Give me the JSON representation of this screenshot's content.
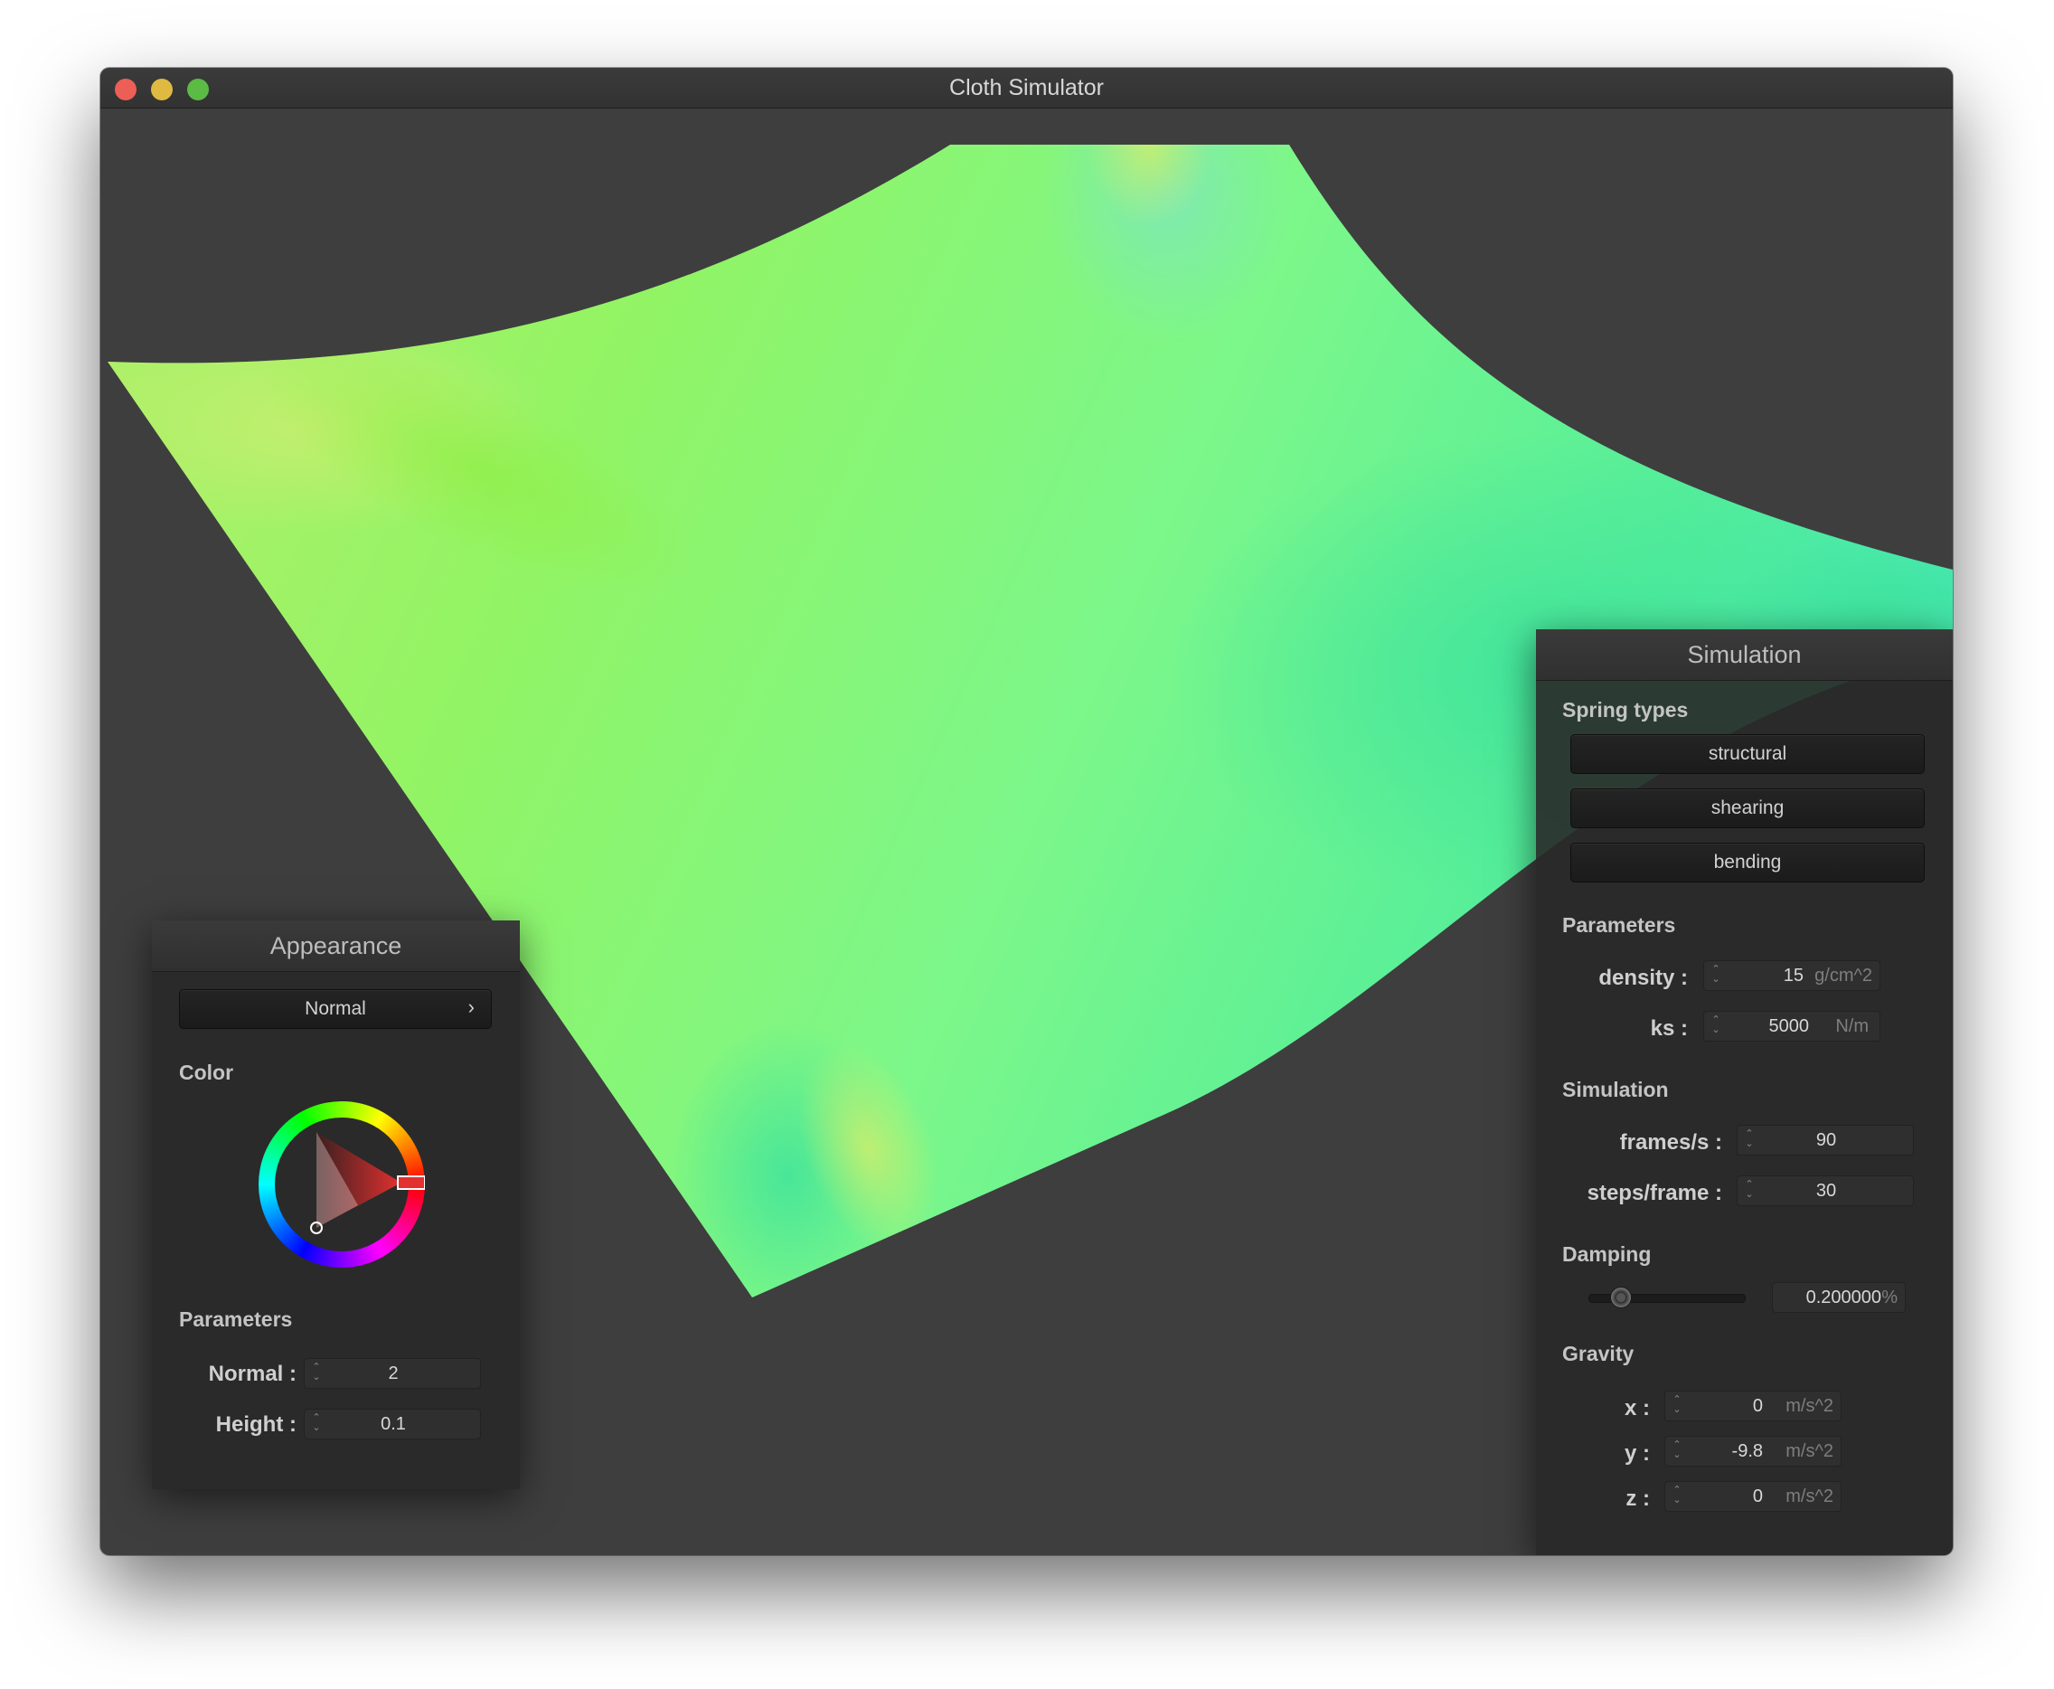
{
  "window": {
    "title": "Cloth Simulator"
  },
  "appearance": {
    "title": "Appearance",
    "shader_select": "Normal",
    "shader_arrow": "›",
    "color_section": "Color",
    "params_section": "Parameters",
    "normal_label": "Normal :",
    "normal_value": "2",
    "height_label": "Height :",
    "height_value": "0.1"
  },
  "simulation": {
    "title": "Simulation",
    "spring_section": "Spring types",
    "spring_buttons": [
      "structural",
      "shearing",
      "bending"
    ],
    "params_section": "Parameters",
    "density_label": "density :",
    "density_value": "15",
    "density_unit": "g/cm^2",
    "ks_label": "ks :",
    "ks_value": "5000",
    "ks_unit": "N/m",
    "sim_section": "Simulation",
    "fps_label": "frames/s :",
    "fps_value": "90",
    "steps_label": "steps/frame :",
    "steps_value": "30",
    "damping_section": "Damping",
    "damping_value": "0.200000",
    "damping_unit": "%",
    "damping_slider_fraction": 0.2,
    "gravity_section": "Gravity",
    "gravity_x_label": "x :",
    "gravity_x": "0",
    "gravity_y_label": "y :",
    "gravity_y": "-9.8",
    "gravity_z_label": "z :",
    "gravity_z": "0",
    "gravity_unit": "m/s^2"
  },
  "colors": {
    "background": "#3e3e3e",
    "panel": "#282828",
    "cloth_green": "#8ef35e",
    "cloth_teal": "#4de8a8",
    "cloth_yellow": "#b9ee6a",
    "picker_selected": "#e33030"
  },
  "icons": [
    "close-window-icon",
    "minimize-window-icon",
    "maximize-window-icon",
    "chevron-right-icon",
    "spinner-arrows-icon",
    "color-wheel-icon"
  ]
}
